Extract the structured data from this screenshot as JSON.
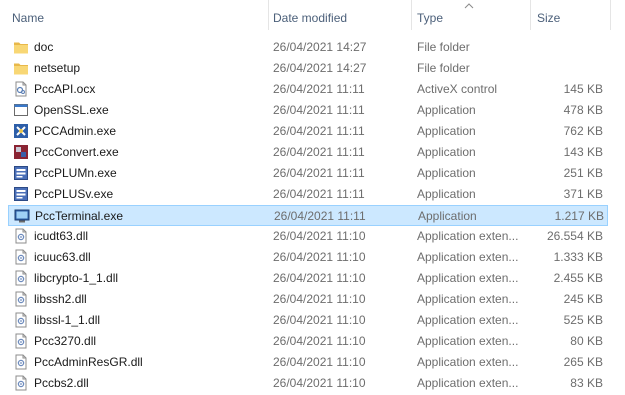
{
  "columns": {
    "name": "Name",
    "date": "Date modified",
    "type": "Type",
    "size": "Size"
  },
  "files": [
    {
      "name": "doc",
      "date": "26/04/2021 14:27",
      "type": "File folder",
      "size": "",
      "icon": "folder-icon"
    },
    {
      "name": "netsetup",
      "date": "26/04/2021 14:27",
      "type": "File folder",
      "size": "",
      "icon": "folder-icon"
    },
    {
      "name": "PccAPI.ocx",
      "date": "26/04/2021 11:11",
      "type": "ActiveX control",
      "size": "145 KB",
      "icon": "ocx-file-icon"
    },
    {
      "name": "OpenSSL.exe",
      "date": "26/04/2021 11:11",
      "type": "Application",
      "size": "478 KB",
      "icon": "exe-icon"
    },
    {
      "name": "PCCAdmin.exe",
      "date": "26/04/2021 11:11",
      "type": "Application",
      "size": "762 KB",
      "icon": "admin-app-icon"
    },
    {
      "name": "PccConvert.exe",
      "date": "26/04/2021 11:11",
      "type": "Application",
      "size": "143 KB",
      "icon": "convert-app-icon"
    },
    {
      "name": "PccPLUMn.exe",
      "date": "26/04/2021 11:11",
      "type": "Application",
      "size": "251 KB",
      "icon": "plu-app-icon"
    },
    {
      "name": "PccPLUSv.exe",
      "date": "26/04/2021 11:11",
      "type": "Application",
      "size": "371 KB",
      "icon": "plu-app-icon"
    },
    {
      "name": "PccTerminal.exe",
      "date": "26/04/2021 11:11",
      "type": "Application",
      "size": "1.217 KB",
      "icon": "terminal-app-icon"
    },
    {
      "name": "icudt63.dll",
      "date": "26/04/2021 11:10",
      "type": "Application exten...",
      "size": "26.554 KB",
      "icon": "dll-icon"
    },
    {
      "name": "icuuc63.dll",
      "date": "26/04/2021 11:10",
      "type": "Application exten...",
      "size": "1.333 KB",
      "icon": "dll-icon"
    },
    {
      "name": "libcrypto-1_1.dll",
      "date": "26/04/2021 11:10",
      "type": "Application exten...",
      "size": "2.455 KB",
      "icon": "dll-icon"
    },
    {
      "name": "libssh2.dll",
      "date": "26/04/2021 11:10",
      "type": "Application exten...",
      "size": "245 KB",
      "icon": "dll-icon"
    },
    {
      "name": "libssl-1_1.dll",
      "date": "26/04/2021 11:10",
      "type": "Application exten...",
      "size": "525 KB",
      "icon": "dll-icon"
    },
    {
      "name": "Pcc3270.dll",
      "date": "26/04/2021 11:10",
      "type": "Application exten...",
      "size": "80 KB",
      "icon": "dll-icon"
    },
    {
      "name": "PccAdminResGR.dll",
      "date": "26/04/2021 11:10",
      "type": "Application exten...",
      "size": "265 KB",
      "icon": "dll-icon"
    },
    {
      "name": "Pccbs2.dll",
      "date": "26/04/2021 11:10",
      "type": "Application exten...",
      "size": "83 KB",
      "icon": "dll-icon"
    }
  ],
  "selected_file": "PccTerminal.exe",
  "colors": {
    "selection_bg": "#cce8ff",
    "selection_border": "#99d1ff",
    "header_text": "#4c607a",
    "folder": "#f8d775"
  }
}
